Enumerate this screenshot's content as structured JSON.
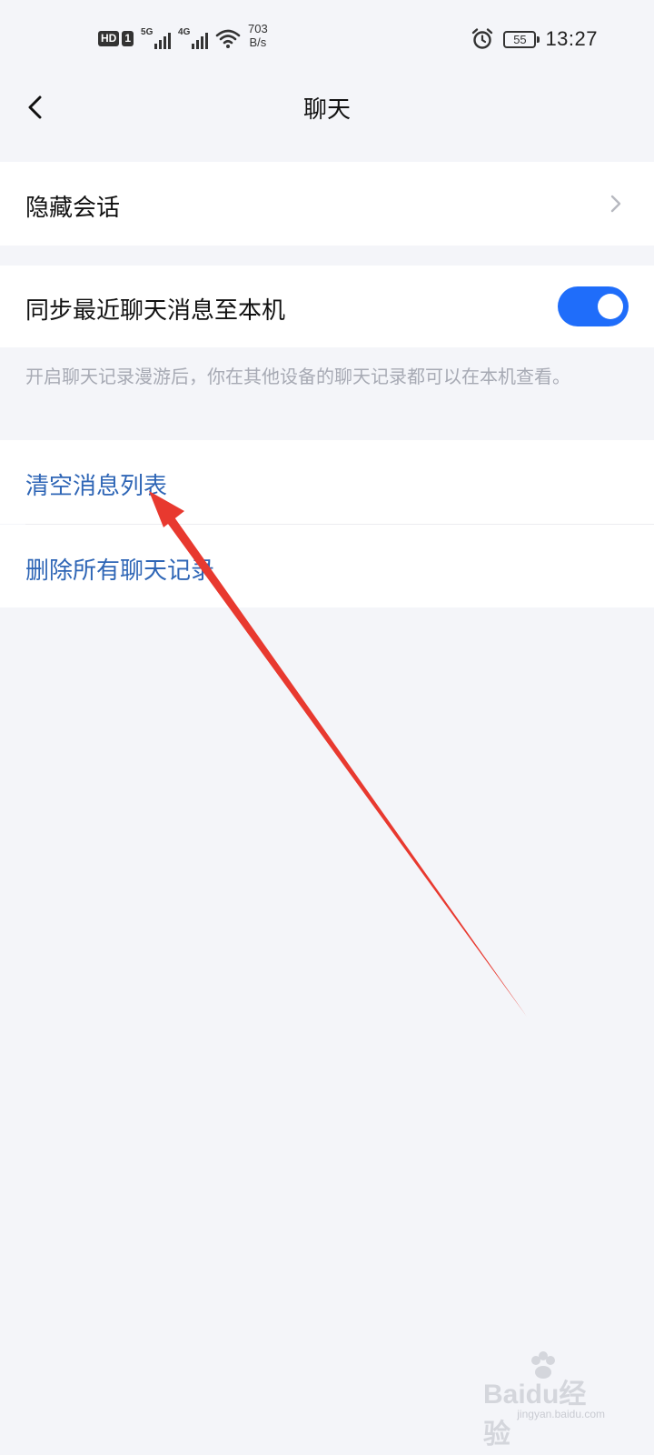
{
  "status_bar": {
    "hd_label": "HD",
    "sim_label": "1",
    "signal1_gen": "5G",
    "signal2_gen": "4G",
    "net_speed_value": "703",
    "net_speed_unit": "B/s",
    "battery_level": "55",
    "time": "13:27"
  },
  "header": {
    "title": "聊天",
    "back_icon": "chevron-left-icon"
  },
  "settings": {
    "hidden_chats": {
      "label": "隐藏会话",
      "icon": "chevron-right-icon"
    },
    "sync_recent": {
      "label": "同步最近聊天消息至本机",
      "toggle_on": true,
      "toggle_color": "#1f6dfa"
    },
    "sync_hint": "开启聊天记录漫游后，你在其他设备的聊天记录都可以在本机查看。",
    "clear_message_list": {
      "label": "清空消息列表"
    },
    "delete_all_history": {
      "label": "删除所有聊天记录"
    }
  },
  "colors": {
    "background": "#f4f5f9",
    "link_text": "#2f66b6",
    "annotation_arrow": "#e8392f"
  },
  "watermark": {
    "main": "Baidu经验",
    "sub": "jingyan.baidu.com"
  }
}
